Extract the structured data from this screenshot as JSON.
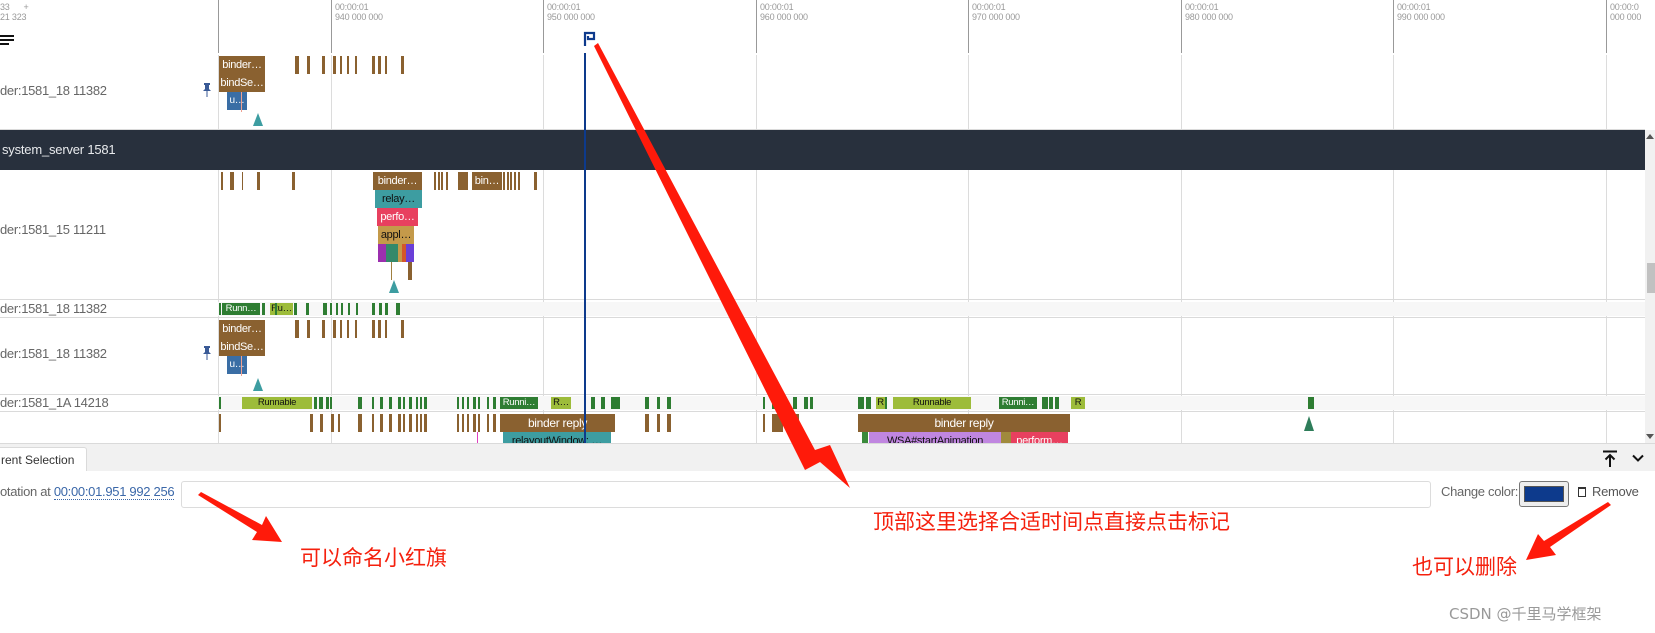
{
  "header": {
    "left_time_top": "33",
    "left_time_bottom": "21 323",
    "plus_symbol": "+",
    "ticks": [
      {
        "top": "00:00:01",
        "bottom": "940 000 000"
      },
      {
        "top": "00:00:01",
        "bottom": "950 000 000"
      },
      {
        "top": "00:00:01",
        "bottom": "960 000 000"
      },
      {
        "top": "00:00:01",
        "bottom": "970 000 000"
      },
      {
        "top": "00:00:01",
        "bottom": "980 000 000"
      },
      {
        "top": "00:00:01",
        "bottom": "990 000 000"
      },
      {
        "top": "00:00:0",
        "bottom": "000 000"
      }
    ],
    "flag_color": "#0d3a8c"
  },
  "tracks": {
    "t1": {
      "label": "der:1581_18 11382",
      "slices": [
        "binder…",
        "bindSe…",
        "u…"
      ]
    },
    "process": {
      "label": "system_server 1581"
    },
    "t2": {
      "label": "der:1581_15 11211",
      "slices": [
        "binder…",
        "bin…",
        "relay…",
        "perfo…",
        "appl…"
      ]
    },
    "t3": {
      "label": "der:1581_18 11382",
      "states": [
        "Runn…",
        "Ru…"
      ]
    },
    "t4": {
      "label": "der:1581_18 11382",
      "slices": [
        "binder…",
        "bindSe…",
        "u…"
      ]
    },
    "t5": {
      "label": "der:1581_1A 14218",
      "states": [
        "Runnable",
        "Runni…",
        "R…",
        "R",
        "R",
        "Runnable",
        "Runni…",
        "R"
      ]
    },
    "t6": {
      "slices": [
        "binder reply",
        "relayoutWindow: …",
        "binder reply",
        "WSA#startAnimation",
        "perform…"
      ]
    }
  },
  "panel": {
    "tab_label": "rent Selection",
    "annotation_prefix": "otation at ",
    "annotation_time": "00:00:01.951 992 256",
    "annotation_name_value": "",
    "change_color_label": "Change color:",
    "flag_color": "#0d3a8c",
    "remove_label": "Remove"
  },
  "callouts": {
    "top": "顶部这里选择合适时间点直接点击标记",
    "name": "可以命名小红旗",
    "delete": "也可以删除"
  },
  "watermark": "CSDN @千里马学框架",
  "colors": {
    "binder": "#8a6130",
    "relay": "#3d9da1",
    "perform": "#e8405f",
    "appl": "#c49a4a",
    "running": "#2e7d32",
    "runnable": "#9dbc3a",
    "u_slice": "#3a6ea5",
    "wsa": "#c086e0",
    "proc_header": "#28303d"
  }
}
